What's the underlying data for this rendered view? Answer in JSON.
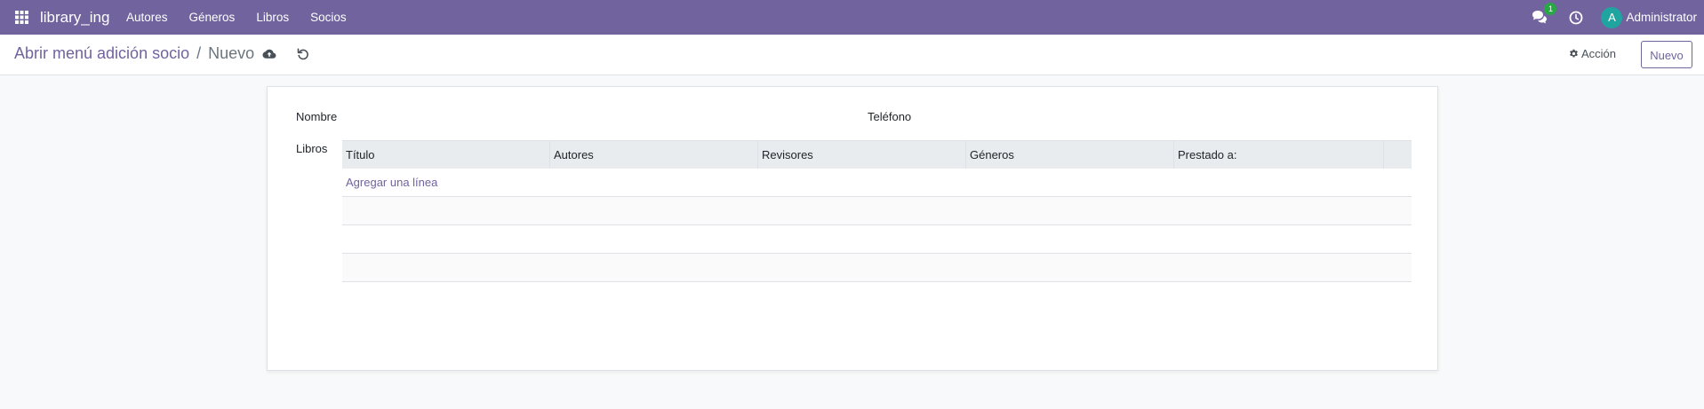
{
  "app": {
    "brand": "library_ing",
    "menu": [
      "Autores",
      "Géneros",
      "Libros",
      "Socios"
    ],
    "chat_count": "1",
    "user": {
      "initial": "A",
      "name": "Administrator"
    },
    "accent": "#71639e"
  },
  "control": {
    "breadcrumb_parent": "Abrir menú adición socio",
    "breadcrumb_sep": "/",
    "breadcrumb_current": "Nuevo",
    "action_label": "Acción",
    "new_label": "Nuevo"
  },
  "form": {
    "nombre_label": "Nombre",
    "nombre_value": "",
    "telefono_label": "Teléfono",
    "telefono_value": "",
    "libros_label": "Libros",
    "libros_columns": [
      "Título",
      "Autores",
      "Revisores",
      "Géneros",
      "Prestado a:"
    ],
    "add_line_label": "Agregar una línea"
  }
}
